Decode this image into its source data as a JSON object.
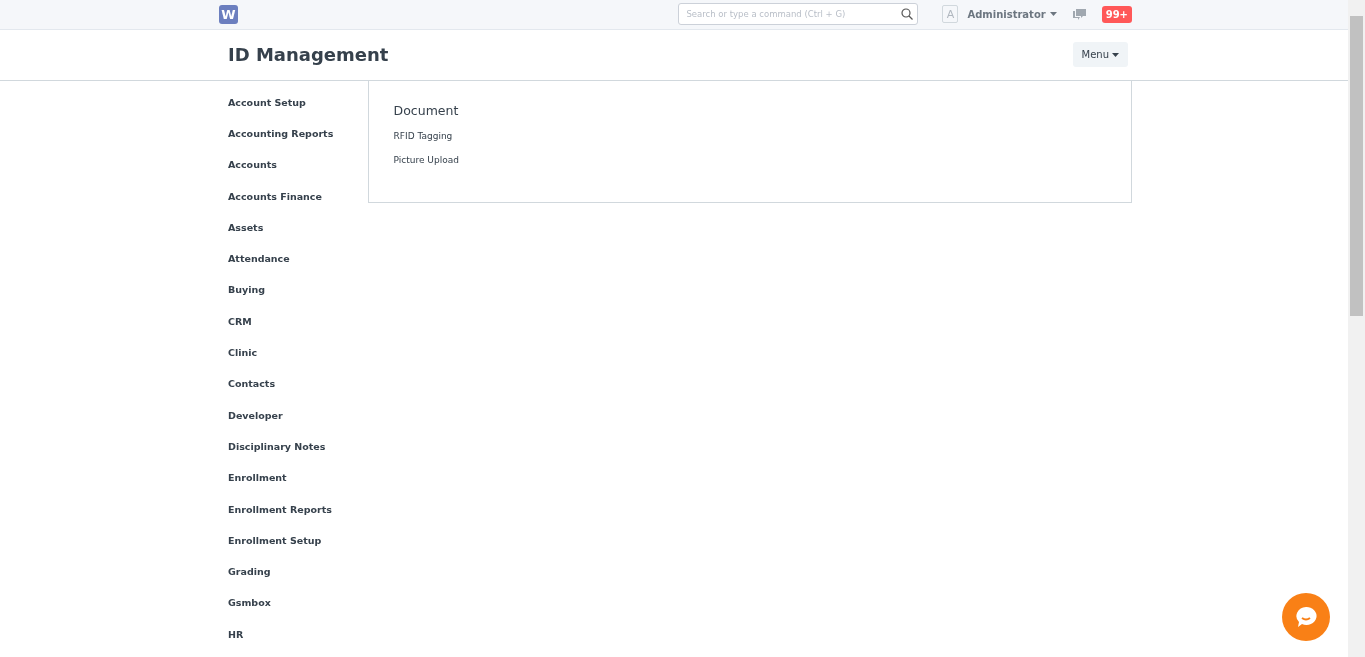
{
  "navbar": {
    "logo": "W",
    "search": {
      "placeholder": "Search or type a command (Ctrl + G)"
    },
    "avatar": "A",
    "user": "Administrator",
    "notifications": "99+"
  },
  "page": {
    "title": "ID Management",
    "menu_button": "Menu"
  },
  "sidebar": {
    "items": [
      {
        "label": "Account Setup"
      },
      {
        "label": "Accounting Reports"
      },
      {
        "label": "Accounts"
      },
      {
        "label": "Accounts Finance"
      },
      {
        "label": "Assets"
      },
      {
        "label": "Attendance"
      },
      {
        "label": "Buying"
      },
      {
        "label": "CRM"
      },
      {
        "label": "Clinic"
      },
      {
        "label": "Contacts"
      },
      {
        "label": "Developer"
      },
      {
        "label": "Disciplinary Notes"
      },
      {
        "label": "Enrollment"
      },
      {
        "label": "Enrollment Reports"
      },
      {
        "label": "Enrollment Setup"
      },
      {
        "label": "Grading"
      },
      {
        "label": "Gsmbox"
      },
      {
        "label": "HR"
      }
    ]
  },
  "section": {
    "title": "Document",
    "links": [
      "RFID Tagging",
      "Picture Upload"
    ]
  }
}
